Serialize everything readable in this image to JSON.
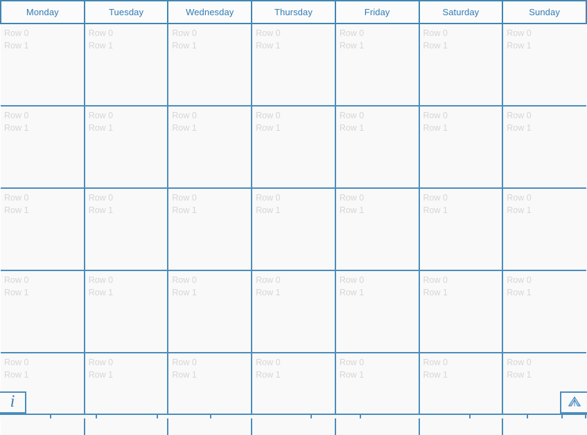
{
  "calendar": {
    "columns": [
      {
        "label": "Monday"
      },
      {
        "label": "Tuesday"
      },
      {
        "label": "Wednesday"
      },
      {
        "label": "Thursday"
      },
      {
        "label": "Friday"
      },
      {
        "label": "Saturday"
      },
      {
        "label": "Sunday"
      }
    ],
    "cell_rows": [
      "Row 0",
      "Row 1"
    ],
    "week_count": 5,
    "colors": {
      "border": "#4a8cbc",
      "header_border": "#3f85b5",
      "header_text": "#2f7cb4",
      "cell_background": "#f9f9f9",
      "placeholder_text": "#d6d6d6",
      "icon_blue": "#3d82bd"
    }
  },
  "corner_controls": {
    "info": {
      "icon": "info-italic-i-icon",
      "glyph": "i"
    },
    "book": {
      "icon": "open-book-icon"
    }
  },
  "bottom_strip": {
    "divider_positions": [
      72,
      138,
      226,
      303,
      448,
      519,
      677,
      760,
      810,
      844
    ]
  }
}
